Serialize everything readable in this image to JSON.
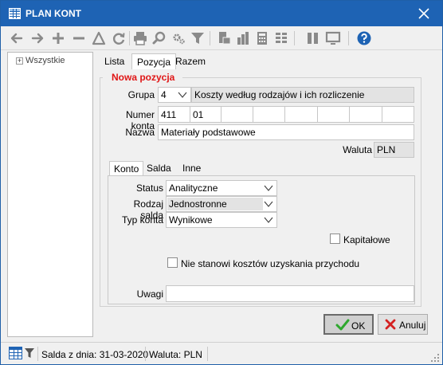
{
  "window": {
    "title": "PLAN KONT"
  },
  "toolbar": {
    "icons": [
      "arrow-left-icon",
      "arrow-right-icon",
      "plus-icon",
      "minus-icon",
      "triangle-icon",
      "refresh-icon",
      "print-icon",
      "search-icon",
      "settings-icon",
      "filter-icon",
      "export-icon",
      "chart-icon",
      "calculator-icon",
      "grid-icon",
      "columns-icon",
      "monitor-icon",
      "help-icon"
    ]
  },
  "tree": {
    "root_label": "Wszystkie"
  },
  "tabs": [
    "Lista",
    "Pozycja",
    "Razem"
  ],
  "group_title": "Nowa pozycja",
  "form": {
    "grupa_label": "Grupa",
    "grupa_code": "4",
    "grupa_name": "Koszty według rodzajów i ich rozliczenie",
    "numer_label": "Numer konta",
    "numer_segments": [
      "411",
      "01",
      "",
      "",
      "",
      "",
      "",
      ""
    ],
    "nazwa_label": "Nazwa",
    "nazwa_value": "Materiały podstawowe",
    "waluta_label": "Waluta",
    "waluta_value": "PLN"
  },
  "subtabs": {
    "konto": "Konto",
    "salda": "Salda",
    "inne": "Inne"
  },
  "konto": {
    "status_label": "Status",
    "status_value": "Analityczne",
    "rodzaj_label": "Rodzaj salda",
    "rodzaj_value": "Jednostronne",
    "typ_label": "Typ konta",
    "typ_value": "Wynikowe",
    "kapitalowe_label": "Kapitałowe",
    "nie_stanowi_label": "Nie stanowi kosztów uzyskania przychodu",
    "uwagi_label": "Uwagi",
    "uwagi_value": ""
  },
  "buttons": {
    "ok": "OK",
    "anuluj": "Anuluj"
  },
  "statusbar": {
    "saldo": "Salda z dnia: 31-03-2020",
    "waluta": "Waluta: PLN"
  },
  "colors": {
    "titlebar": "#1e63b4",
    "accent_red": "#e01616",
    "ok_green": "#2ea82e",
    "cancel_red": "#d42020"
  }
}
